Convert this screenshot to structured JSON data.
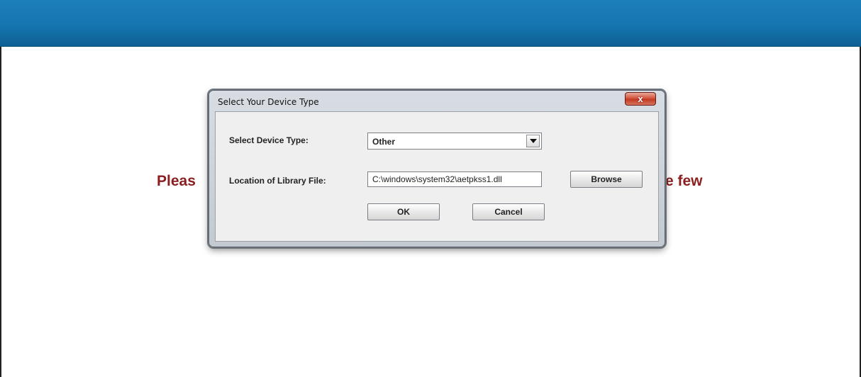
{
  "background": {
    "message_left": "Pleas",
    "message_right": "e few"
  },
  "dialog": {
    "title": "Select Your Device Type",
    "close_label": "x",
    "device_type_label": "Select Device Type:",
    "device_type_value": "Other",
    "library_label": "Location of Library File:",
    "library_path": "C:\\windows\\system32\\aetpkss1.dll",
    "browse_label": "Browse",
    "ok_label": "OK",
    "cancel_label": "Cancel"
  },
  "colors": {
    "header_bar": "#1575b0",
    "message_text": "#8b1f1f",
    "close_button": "#c23a22"
  }
}
